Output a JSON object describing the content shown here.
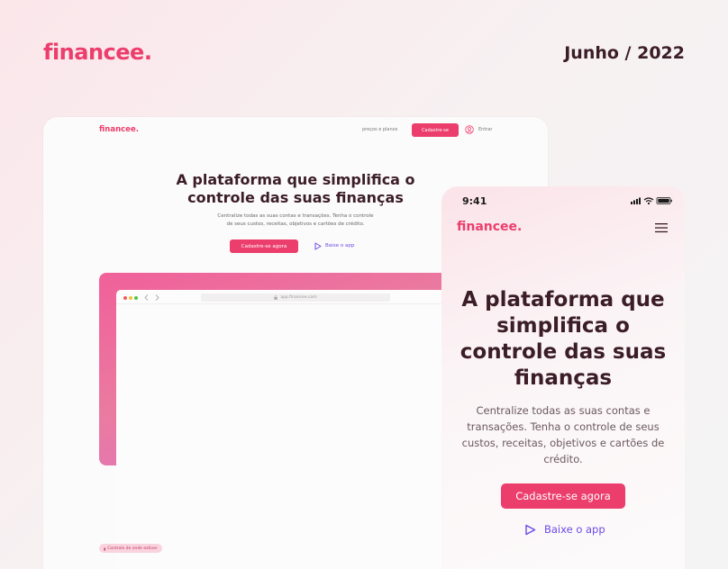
{
  "header": {
    "brand": "financee.",
    "date": "Junho / 2022"
  },
  "desktop": {
    "nav": {
      "logo": "financee.",
      "link": "preços e planos",
      "cta": "Cadastre-se",
      "user_icon": "user-circle-icon",
      "login": "Entrar"
    },
    "hero": {
      "title_line1": "A plataforma que simplifica o",
      "title_line2": "controle das suas finanças",
      "subtitle_line1": "Centralize todas as suas contas e transações. Tenha o controle",
      "subtitle_line2": "de seus custos, receitas, objetivos e cartões de crédito.",
      "cta": "Cadastre-se agora",
      "app_icon": "play-icon",
      "app_link": "Baixe o app"
    },
    "browser": {
      "url": "app.financee.com",
      "lock_icon": "lock-icon"
    },
    "badge": "Controle de onde estiver"
  },
  "mobile": {
    "status": {
      "time": "9:41"
    },
    "logo": "financee.",
    "menu_icon": "hamburger-icon",
    "hero": {
      "title_line1": "A plataforma que",
      "title_line2": "simplifica o",
      "title_line3": "controle das suas",
      "title_line4": "finanças",
      "subtitle_line1": "Centralize todas as suas contas e",
      "subtitle_line2": "transações. Tenha o controle de seus",
      "subtitle_line3": "custos, receitas, objetivos e cartões de",
      "subtitle_line4": "crédito.",
      "cta": "Cadastre-se agora",
      "app_icon": "play-icon",
      "app_link": "Baixe o app"
    }
  },
  "colors": {
    "brand": "#ec3e6c",
    "dark_text": "#3b1d27",
    "link_purple": "#6c4ae8"
  }
}
